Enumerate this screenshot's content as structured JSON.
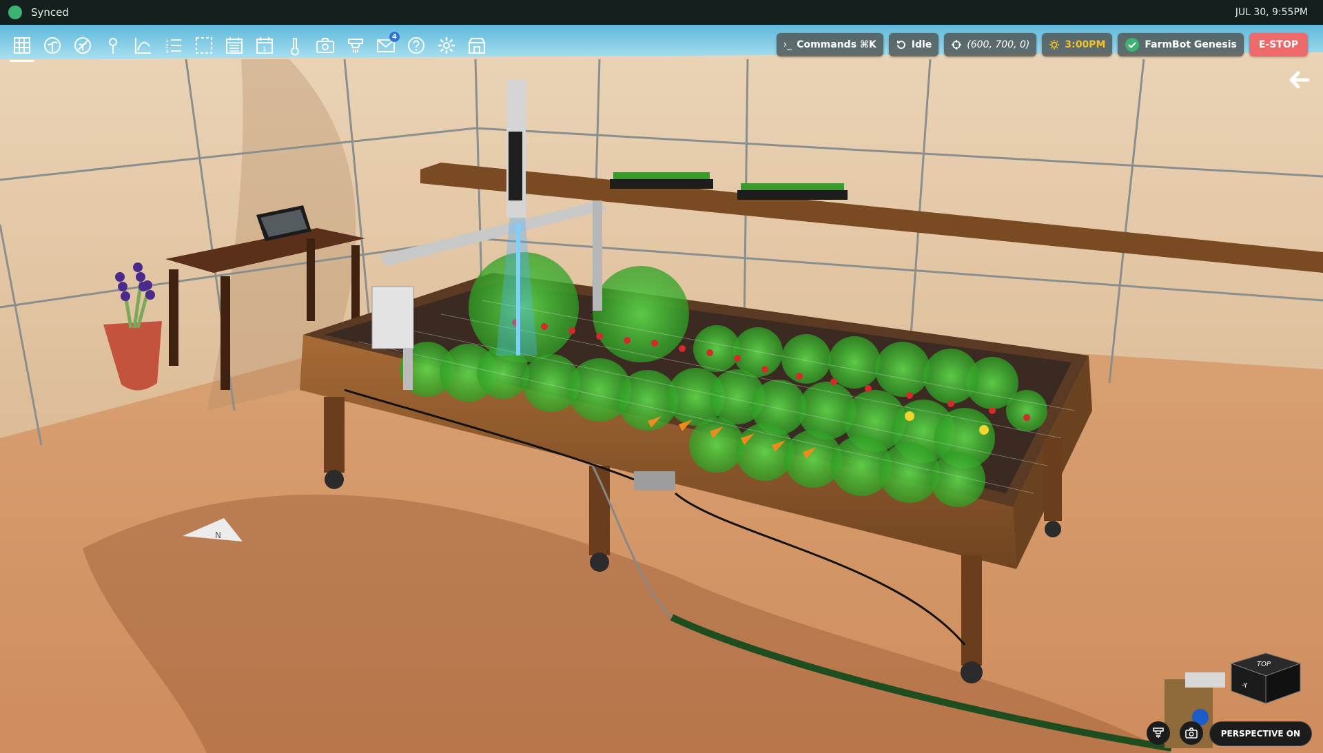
{
  "status": {
    "text": "Synced",
    "dot_color": "#3cb371"
  },
  "datetime": "JUL 30, 9:55PM",
  "nav": {
    "items": [
      {
        "name": "map-icon"
      },
      {
        "name": "plants-icon"
      },
      {
        "name": "weeds-icon"
      },
      {
        "name": "points-icon"
      },
      {
        "name": "curves-icon"
      },
      {
        "name": "sequences-icon"
      },
      {
        "name": "groups-icon"
      },
      {
        "name": "regimens-icon"
      },
      {
        "name": "events-icon"
      },
      {
        "name": "sensors-icon"
      },
      {
        "name": "photos-icon"
      },
      {
        "name": "tools-icon"
      },
      {
        "name": "messages-icon",
        "badge": "4"
      },
      {
        "name": "help-icon"
      },
      {
        "name": "settings-icon"
      },
      {
        "name": "shop-icon"
      }
    ]
  },
  "controls": {
    "commands": "Commands ⌘K",
    "state": "Idle",
    "position": "(600, 700, 0)",
    "time": "3:00PM",
    "device": "FarmBot Genesis",
    "estop": "E-STOP"
  },
  "view": {
    "perspective": "PERSPECTIVE ON",
    "cube_top": "TOP",
    "cube_front": "-Y",
    "compass": "N"
  },
  "colors": {
    "accent_green": "#3cb371",
    "estop_red": "#ee6a6a",
    "sun_yellow": "#f5c227"
  }
}
